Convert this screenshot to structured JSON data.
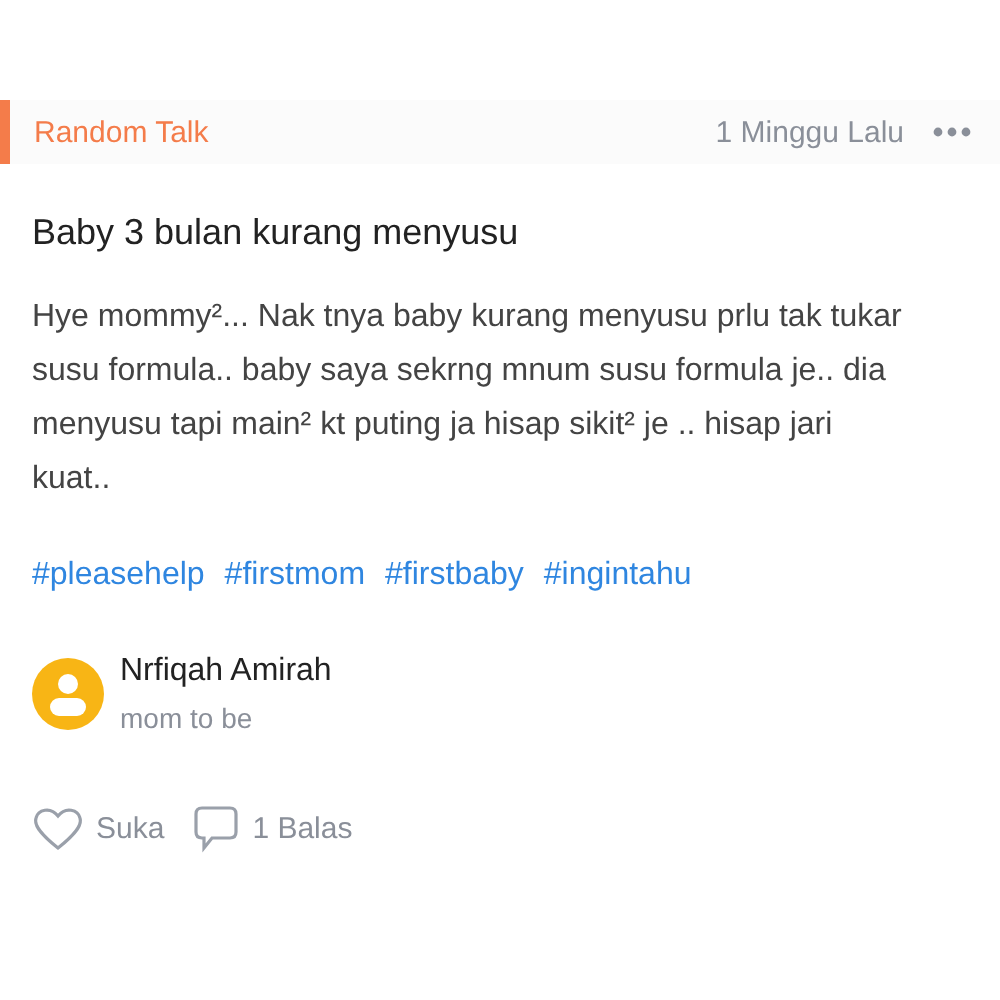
{
  "category": "Random Talk",
  "time": "1 Minggu Lalu",
  "title": "Baby 3 bulan kurang menyusu",
  "body": "Hye mommy²... Nak tnya baby kurang menyusu prlu tak tukar susu formula.. baby saya sekrng mnum susu formula je.. dia menyusu tapi main² kt puting ja hisap sikit² je .. hisap jari kuat..",
  "hashtags": [
    "#pleasehelp",
    "#firstmom",
    "#firstbaby",
    "#ingintahu"
  ],
  "author": {
    "name": "Nrfiqah Amirah",
    "subtitle": "mom to be"
  },
  "actions": [
    {
      "kind": "like",
      "label": "Suka"
    },
    {
      "kind": "reply",
      "label": "1 Balas"
    }
  ]
}
